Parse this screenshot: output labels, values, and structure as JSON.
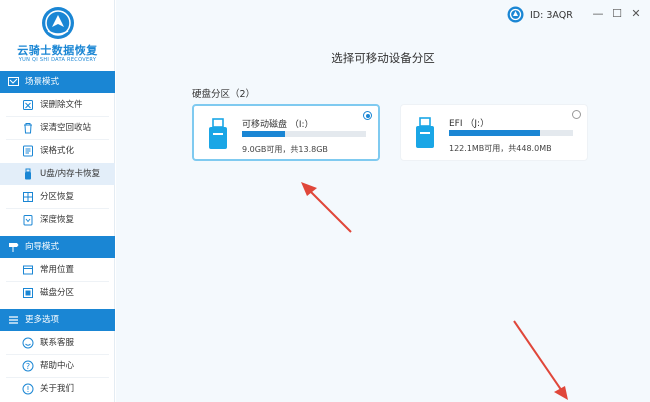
{
  "app": {
    "logo_title": "云骑士数据恢复",
    "logo_subtitle": "YUN QI SHI DATA RECOVERY"
  },
  "sidebar": {
    "sections": [
      {
        "label": "场景模式",
        "icon": "scene-mode-icon"
      },
      {
        "label": "向导模式",
        "icon": "guide-mode-icon"
      },
      {
        "label": "更多选项",
        "icon": "more-options-icon"
      }
    ],
    "items": [
      {
        "label": "误删除文件",
        "icon": "delete-file-icon"
      },
      {
        "label": "误清空回收站",
        "icon": "recycle-bin-icon"
      },
      {
        "label": "误格式化",
        "icon": "format-icon"
      },
      {
        "label": "U盘/内存卡恢复",
        "icon": "usb-icon",
        "active": true
      },
      {
        "label": "分区恢复",
        "icon": "partition-icon"
      },
      {
        "label": "深度恢复",
        "icon": "deep-recovery-icon"
      },
      {
        "label": "常用位置",
        "icon": "common-location-icon"
      },
      {
        "label": "磁盘分区",
        "icon": "disk-partition-icon"
      },
      {
        "label": "联系客服",
        "icon": "customer-service-icon"
      },
      {
        "label": "帮助中心",
        "icon": "help-icon"
      },
      {
        "label": "关于我们",
        "icon": "about-icon"
      }
    ]
  },
  "header": {
    "id_label": "ID: 3AQR",
    "minimize": "—",
    "maximize": "☐",
    "close": "✕"
  },
  "main": {
    "title": "选择可移动设备分区",
    "group_label": "硬盘分区（2）",
    "devices": [
      {
        "name": "可移动磁盘  （I:）",
        "size": "9.0GB可用，共13.8GB",
        "used_fraction": 0.35,
        "selected": true
      },
      {
        "name": "EFI  （J:）",
        "size": "122.1MB可用，共448.0MB",
        "used_fraction": 0.73,
        "selected": false
      }
    ]
  },
  "colors": {
    "accent": "#1a86d4",
    "selected_border": "#7fcaf0",
    "annotation_arrow": "#e0473a"
  }
}
